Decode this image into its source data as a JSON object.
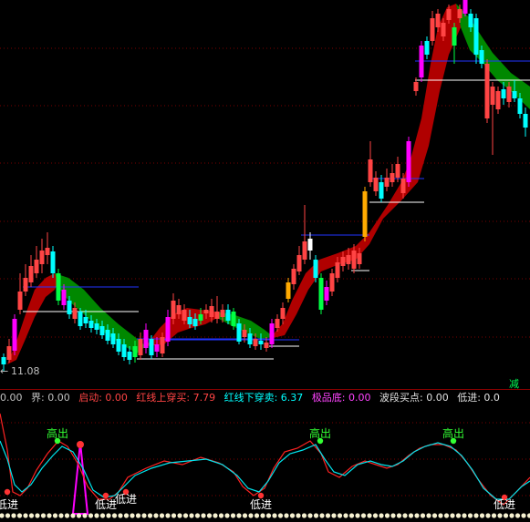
{
  "colors": {
    "up": "#ff4444",
    "down": "#00ffff",
    "ribbon_up": "#b00000",
    "ribbon_down": "#008800",
    "grid": "#7a0000",
    "white_line": "#ffffff",
    "blue_line": "#2233ff",
    "magenta": "#ff00ff",
    "yellow": "#ffaa00",
    "green_bar": "#00ff44",
    "curve_red": "#ff2222",
    "curve_cyan": "#00e5ee"
  },
  "main": {
    "low_price_label": "11.08",
    "low_arrow": "←",
    "reduce_label": "减"
  },
  "legend": {
    "items": [
      {
        "text": "0.00",
        "color": "#c0c0c0"
      },
      {
        "text": "界: 0.00",
        "color": "#c0c0c0"
      },
      {
        "text": "启动: 0.00",
        "color": "#ff4444"
      },
      {
        "text": "红线上穿买: 7.79",
        "color": "#ff4444"
      },
      {
        "text": "红线下穿卖: 6.37",
        "color": "#00ffff"
      },
      {
        "text": "极品底: 0.00",
        "color": "#ff44ff"
      },
      {
        "text": "波段买点: 0.00",
        "color": "#e0e0e0"
      },
      {
        "text": "低进: 0.0",
        "color": "#e0e0e0"
      }
    ]
  },
  "sub": {
    "signals": [
      {
        "label": "高出",
        "kind": "high"
      },
      {
        "label": "低进",
        "kind": "low"
      },
      {
        "label": "低进",
        "kind": "low"
      },
      {
        "label": "低进",
        "kind": "low"
      },
      {
        "label": "高出",
        "kind": "high"
      },
      {
        "label": "低进",
        "kind": "low"
      },
      {
        "label": "高出",
        "kind": "high"
      },
      {
        "label": "低进",
        "kind": "low"
      }
    ]
  }
}
